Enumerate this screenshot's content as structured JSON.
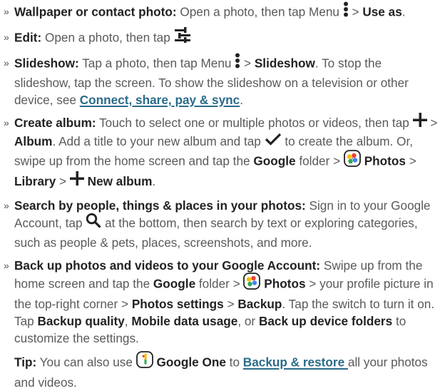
{
  "bullet_char": "»",
  "items": {
    "wallpaper": {
      "title": "Wallpaper or contact photo:",
      "t1": " Open a photo, then tap Menu ",
      "t2": " > ",
      "b1": "Use as",
      "t3": "."
    },
    "edit": {
      "title": "Edit:",
      "t1": " Open a photo, then tap "
    },
    "slideshow": {
      "title": "Slideshow:",
      "t1": " Tap a photo, then tap Menu ",
      "t2": " > ",
      "b1": "Slideshow",
      "t3": ". To stop the slideshow, tap the screen. To show the slideshow on a television or other device, see ",
      "link": "Connect, share, pay & sync",
      "t4": "."
    },
    "album": {
      "title": "Create album:",
      "t1": " Touch to select one or multiple photos or videos, then tap ",
      "t2": " > ",
      "b1": "Album",
      "t3": ". Add a title to your new album and tap ",
      "t4": " to create the album. Or, swipe up from the home screen and tap the ",
      "b2": "Google",
      "t5": " folder > ",
      "b3": "Photos",
      "t6": " > ",
      "b4": "Library",
      "t7": " > ",
      "b5": "New album",
      "t8": "."
    },
    "search": {
      "title": "Search by people, things & places in your photos:",
      "t1": " Sign in to your Google Account, tap ",
      "t2": " at the bottom, then search by text or exploring categories, such as people & pets, places, screenshots, and more."
    },
    "backup": {
      "title": "Back up photos and videos to your Google Account:",
      "t1": " Swipe up from the home screen and tap the ",
      "b1": "Google",
      "t2": " folder > ",
      "b2": "Photos",
      "t3": " > your profile picture in the top-right corner > ",
      "b3": "Photos settings",
      "t4": " > ",
      "b4": "Backup",
      "t5": ". Tap the switch to turn it on. Tap ",
      "b5": "Backup quality",
      "t6": ", ",
      "b6": "Mobile data usage",
      "t7": ", or ",
      "b7": "Back up device folders",
      "t8": " to customize the settings."
    }
  },
  "tip": {
    "label": "Tip:",
    "t1": " You can also use ",
    "b1": "Google One",
    "t2": " to ",
    "link": "Backup & restore ",
    "t3": "all your photos and videos."
  },
  "icons": {
    "menu": "more-vert-icon",
    "edit": "tune-icon",
    "add": "plus-icon",
    "check": "checkmark-icon",
    "search": "magnifier-icon",
    "photos": "google-photos-icon",
    "google_one": "google-one-icon"
  }
}
